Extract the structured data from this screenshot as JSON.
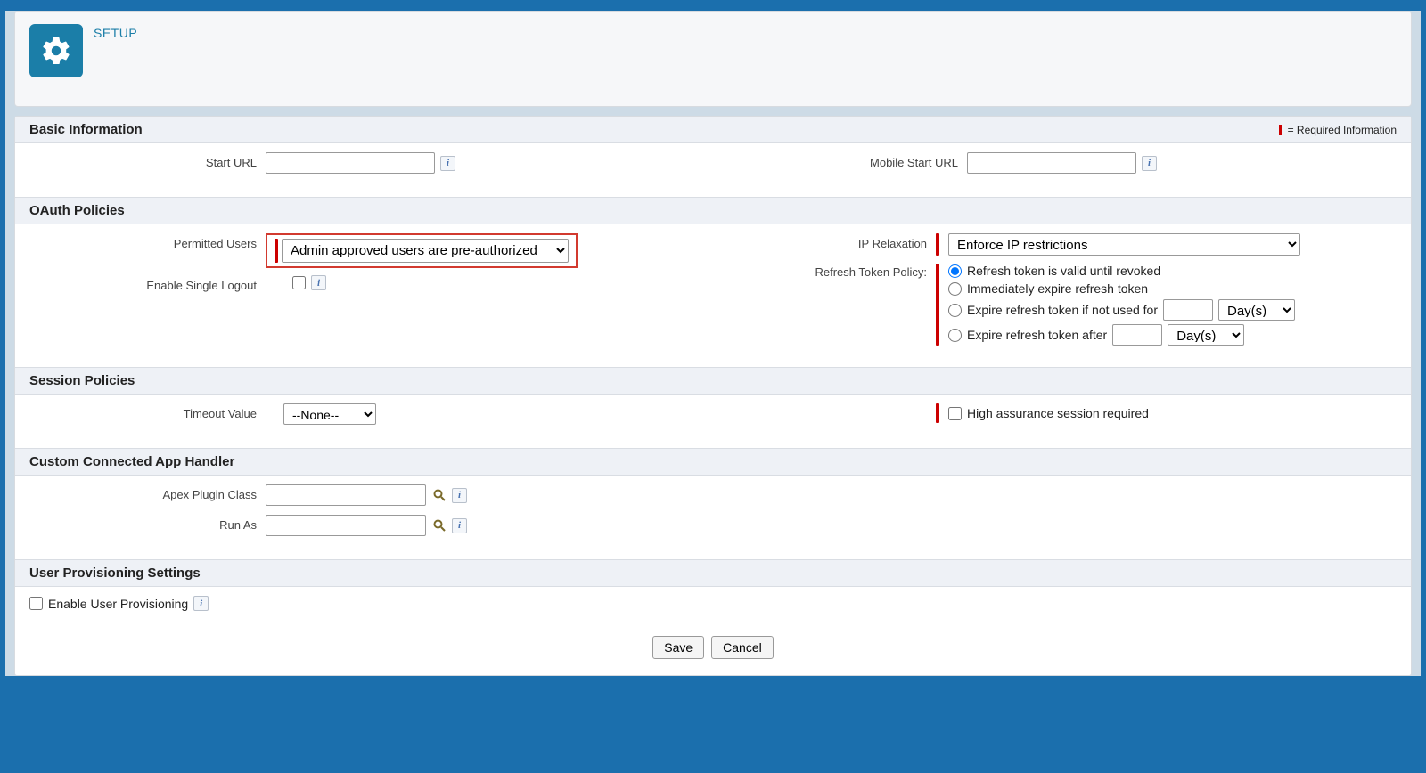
{
  "header": {
    "title": "SETUP"
  },
  "sections": {
    "basic": {
      "title": "Basic Information",
      "required_note": "= Required Information",
      "start_url_label": "Start URL",
      "start_url_value": "",
      "mobile_start_url_label": "Mobile Start URL",
      "mobile_start_url_value": ""
    },
    "oauth": {
      "title": "OAuth Policies",
      "permitted_users_label": "Permitted Users",
      "permitted_users_value": "Admin approved users are pre-authorized",
      "enable_single_logout_label": "Enable Single Logout",
      "ip_relaxation_label": "IP Relaxation",
      "ip_relaxation_value": "Enforce IP restrictions",
      "refresh_token_policy_label": "Refresh Token Policy:",
      "refresh_options": {
        "until_revoked": "Refresh token is valid until revoked",
        "immediately": "Immediately expire refresh token",
        "not_used_for": "Expire refresh token if not used for",
        "after": "Expire refresh token after"
      },
      "days_unit": "Day(s)"
    },
    "session": {
      "title": "Session Policies",
      "timeout_label": "Timeout Value",
      "timeout_value": "--None--",
      "high_assurance_label": "High assurance session required"
    },
    "handler": {
      "title": "Custom Connected App Handler",
      "apex_plugin_label": "Apex Plugin Class",
      "apex_plugin_value": "",
      "run_as_label": "Run As",
      "run_as_value": ""
    },
    "provisioning": {
      "title": "User Provisioning Settings",
      "enable_label": "Enable User Provisioning"
    }
  },
  "buttons": {
    "save": "Save",
    "cancel": "Cancel"
  }
}
